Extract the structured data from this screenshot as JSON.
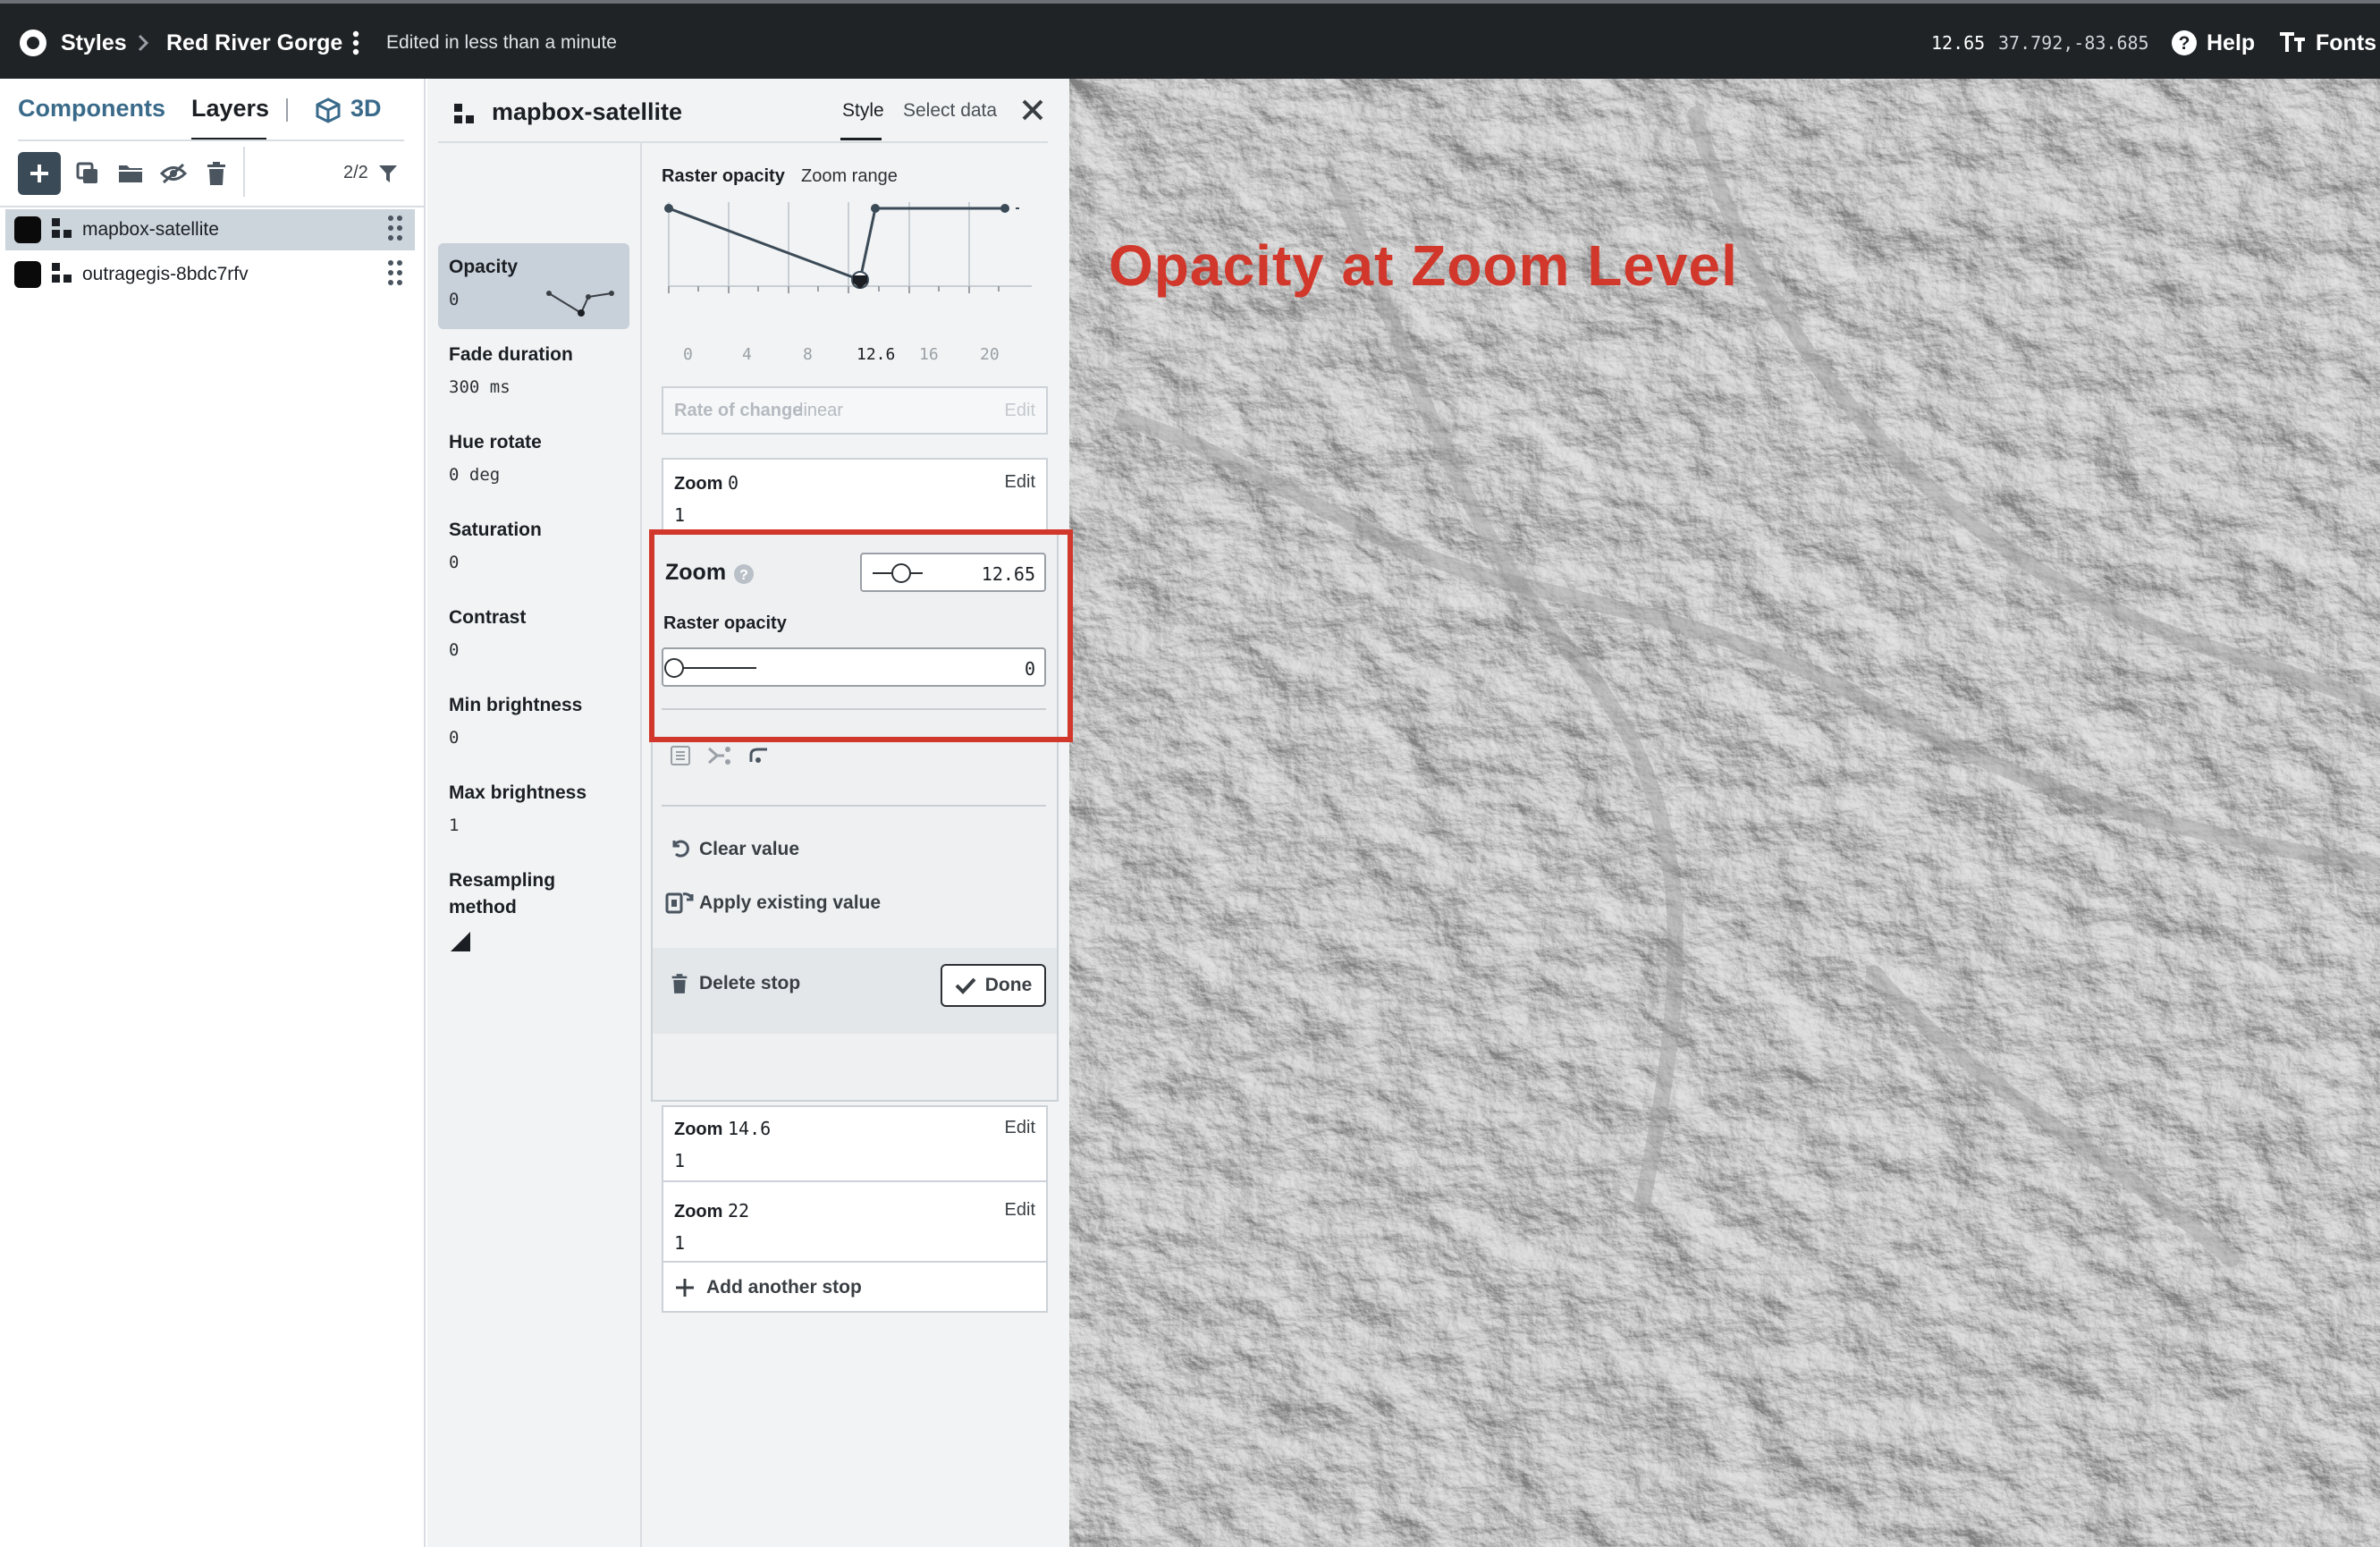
{
  "topbar": {
    "styles_label": "Styles",
    "project_name": "Red River Gorge",
    "edited_status": "Edited in less than a minute",
    "zoom": "12.65",
    "coords": "37.792,-83.685",
    "help_label": "Help",
    "fonts_label": "Fonts"
  },
  "left_panel": {
    "tabs": {
      "components": "Components",
      "layers": "Layers",
      "three_d": "3D"
    },
    "filter_count": "2/2",
    "layers": [
      {
        "name": "mapbox-satellite",
        "selected": true
      },
      {
        "name": "outragegis-8bdc7rfv",
        "selected": false
      }
    ]
  },
  "editor": {
    "layer_name": "mapbox-satellite",
    "tabs": {
      "style": "Style",
      "select_data": "Select data"
    },
    "properties": [
      {
        "name": "Opacity",
        "value": "0"
      },
      {
        "name": "Fade duration",
        "value": "300 ms"
      },
      {
        "name": "Hue rotate",
        "value": "0 deg"
      },
      {
        "name": "Saturation",
        "value": "0"
      },
      {
        "name": "Contrast",
        "value": "0"
      },
      {
        "name": "Min brightness",
        "value": "0"
      },
      {
        "name": "Max brightness",
        "value": "1"
      },
      {
        "name": "Resampling",
        "value2": "method"
      }
    ],
    "chart_header": {
      "title": "Raster opacity",
      "subtitle": "Zoom range"
    },
    "chart_ticks": [
      "0",
      "4",
      "8",
      "12.6",
      "16",
      "20"
    ],
    "rate_of_change": {
      "label": "Rate of change",
      "value": "linear",
      "edit": "Edit"
    },
    "stops": [
      {
        "label": "Zoom",
        "zoom": "0",
        "value": "1",
        "edit": "Edit"
      },
      {
        "label": "Zoom",
        "zoom": "14.6",
        "value": "1",
        "edit": "Edit"
      },
      {
        "label": "Zoom",
        "zoom": "22",
        "value": "1",
        "edit": "Edit"
      }
    ],
    "stop_editor": {
      "zoom_label": "Zoom",
      "zoom_value": "12.65",
      "zoom_fraction": 0.575,
      "raster_label": "Raster opacity",
      "raster_value": "0",
      "raster_fraction": 0.0,
      "clear_value": "Clear value",
      "apply_existing": "Apply existing value",
      "delete_stop": "Delete stop",
      "done": "Done"
    },
    "add_stop": "Add another stop"
  },
  "map": {
    "annotation": "Opacity at Zoom Level"
  }
}
